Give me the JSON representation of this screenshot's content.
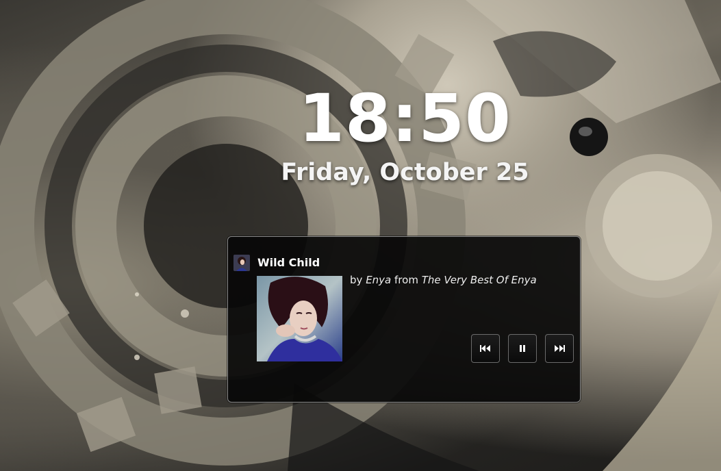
{
  "lockscreen": {
    "time": "18:50",
    "date": "Friday, October 25"
  },
  "media_player": {
    "track_title": "Wild Child",
    "by_label": "by",
    "artist": "Enya",
    "from_label": "from",
    "album": "The Very Best Of Enya",
    "controls": {
      "previous_icon": "skip-previous-icon",
      "pause_icon": "pause-icon",
      "next_icon": "skip-next-icon"
    }
  },
  "colors": {
    "panel_background": "#080808",
    "panel_border": "#8a8a8a",
    "text": "#ffffff"
  }
}
